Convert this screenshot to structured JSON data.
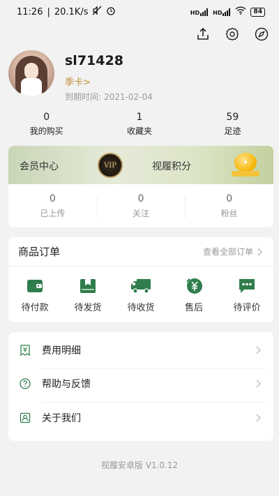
{
  "status_bar": {
    "time": "11:26",
    "speed": "20.1K/s",
    "signal1": "HD",
    "signal2": "HD",
    "battery": "84"
  },
  "top_actions": [
    "share-icon",
    "settings-icon",
    "compass-icon"
  ],
  "profile": {
    "username": "sl71428",
    "member_type": "季卡>",
    "expire_label": "到期时间:",
    "expire_date": "2021-02-04"
  },
  "stats": [
    {
      "num": "0",
      "label": "我的购买"
    },
    {
      "num": "1",
      "label": "收藏夹"
    },
    {
      "num": "59",
      "label": "足迹"
    }
  ],
  "member_card": {
    "center_label": "会员中心",
    "vip_text": "VIP",
    "points_label": "视履积分",
    "stats": [
      {
        "num": "0",
        "label": "已上传"
      },
      {
        "num": "0",
        "label": "关注"
      },
      {
        "num": "0",
        "label": "粉丝"
      }
    ]
  },
  "orders": {
    "title": "商品订单",
    "view_all": "查看全部订单",
    "items": [
      {
        "label": "待付款",
        "icon": "wallet-icon"
      },
      {
        "label": "待发货",
        "icon": "package-icon"
      },
      {
        "label": "待收货",
        "icon": "truck-icon"
      },
      {
        "label": "售后",
        "icon": "yuan-refund-icon"
      },
      {
        "label": "待评价",
        "icon": "comment-icon"
      }
    ]
  },
  "menu": [
    {
      "label": "费用明细",
      "icon": "receipt-icon"
    },
    {
      "label": "帮助与反馈",
      "icon": "help-icon"
    },
    {
      "label": "关于我们",
      "icon": "contact-icon"
    }
  ],
  "footer": {
    "version": "视履安卓版 V1.0.12"
  },
  "colors": {
    "accent_green": "#2f7d4c",
    "gold": "#c3913a",
    "background": "#f2f2f2"
  }
}
